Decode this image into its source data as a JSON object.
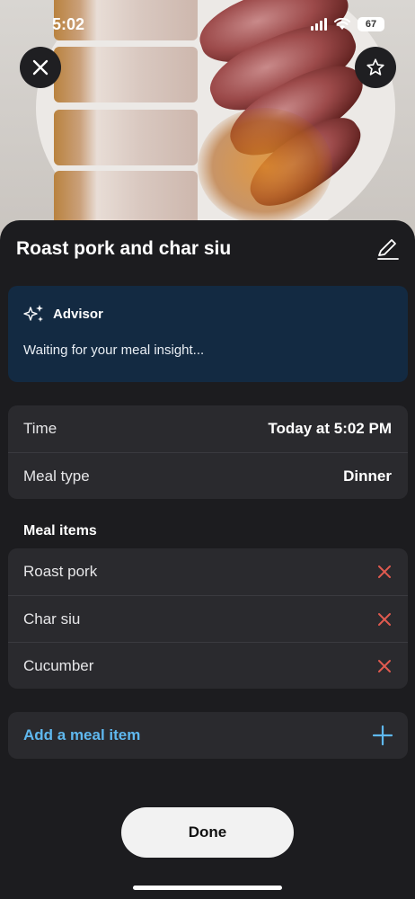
{
  "status_bar": {
    "time": "5:02",
    "battery": "67"
  },
  "header": {
    "close_icon": "close-icon",
    "favorite_icon": "star-icon"
  },
  "meal": {
    "title": "Roast pork and char siu",
    "edit_icon": "pencil-icon"
  },
  "advisor": {
    "label": "Advisor",
    "message": "Waiting for your meal insight...",
    "icon": "sparkles-icon"
  },
  "details": [
    {
      "label": "Time",
      "value": "Today at 5:02 PM"
    },
    {
      "label": "Meal type",
      "value": "Dinner"
    }
  ],
  "meal_items": {
    "heading": "Meal items",
    "items": [
      {
        "label": "Roast pork"
      },
      {
        "label": "Char siu"
      },
      {
        "label": "Cucumber"
      }
    ],
    "remove_icon": "remove-x-icon"
  },
  "add_item": {
    "label": "Add a meal item",
    "icon": "plus-icon"
  },
  "done_button": {
    "label": "Done"
  },
  "colors": {
    "sheet_bg": "#1c1c1f",
    "card_bg": "#2a2a2e",
    "advisor_bg": "#132a42",
    "accent_blue": "#5fb8ef",
    "remove_red": "#e05a4f"
  }
}
